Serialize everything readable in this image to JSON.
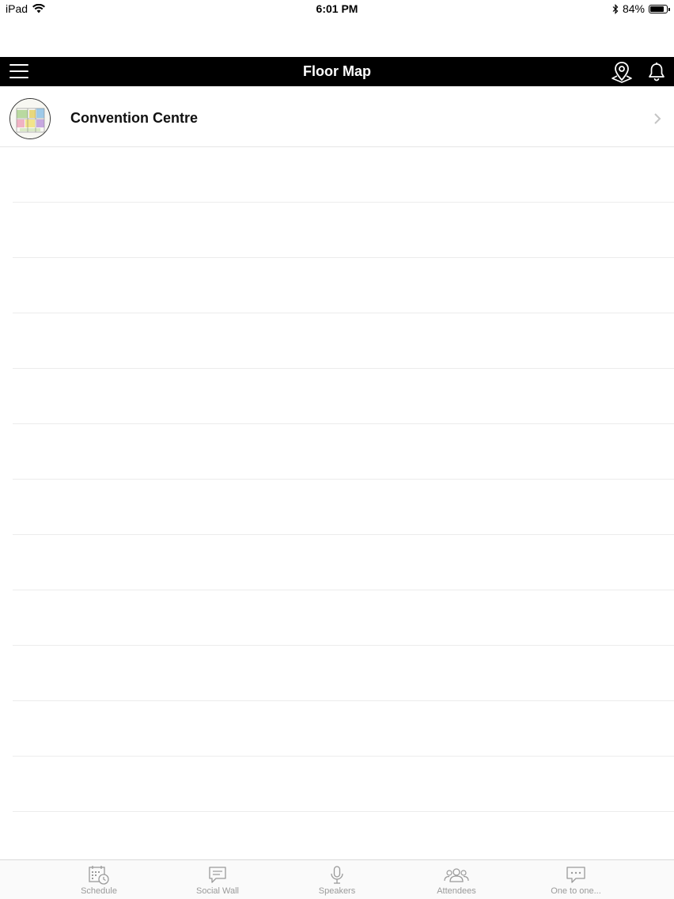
{
  "status_bar": {
    "device": "iPad",
    "time": "6:01 PM",
    "battery": "84%",
    "battery_level": 0.84,
    "icons": [
      "wifi-icon",
      "bluetooth-icon",
      "battery-icon"
    ]
  },
  "navbar": {
    "title": "Floor Map",
    "icons": [
      "menu-icon",
      "location-pin-icon",
      "bell-icon"
    ]
  },
  "list": {
    "items": [
      {
        "label": "Convention Centre",
        "icon": "floor-plan-thumbnail"
      }
    ]
  },
  "tabbar": {
    "tabs": [
      {
        "label": "Schedule",
        "icon": "calendar-clock-icon"
      },
      {
        "label": "Social Wall",
        "icon": "chat-bubble-icon"
      },
      {
        "label": "Speakers",
        "icon": "microphone-icon"
      },
      {
        "label": "Attendees",
        "icon": "people-group-icon"
      },
      {
        "label": "One to one...",
        "icon": "conversation-icon"
      }
    ]
  },
  "colors": {
    "navbar_bg": "#000000",
    "navbar_text": "#ffffff",
    "tab_inactive": "#9a9a9a",
    "separator": "#e6e6e6"
  }
}
